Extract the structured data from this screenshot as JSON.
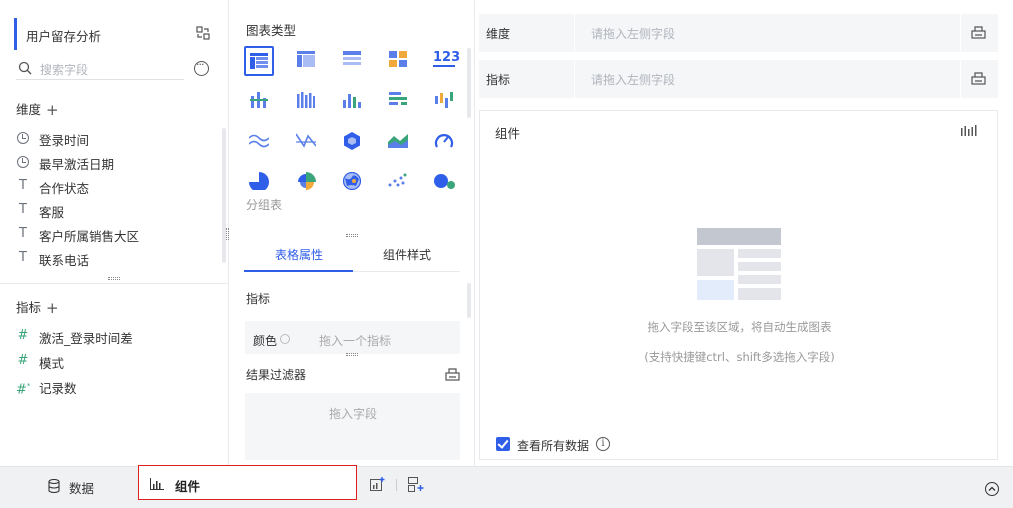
{
  "left_panel": {
    "dataset_title": "用户留存分析",
    "search_placeholder": "搜索字段",
    "dimension_title": "维度",
    "dimensions": [
      {
        "label": "登录时间",
        "icon": "clock-icon"
      },
      {
        "label": "最早激活日期",
        "icon": "clock-icon"
      },
      {
        "label": "合作状态",
        "icon": "text-type-icon"
      },
      {
        "label": "客服",
        "icon": "text-type-icon"
      },
      {
        "label": "客户所属销售大区",
        "icon": "text-type-icon"
      },
      {
        "label": "联系电话",
        "icon": "text-type-icon"
      }
    ],
    "metric_title": "指标",
    "metrics": [
      {
        "label": "激活_登录时间差",
        "icon": "hash-icon"
      },
      {
        "label": "模式",
        "icon": "hash-icon"
      },
      {
        "label": "记录数",
        "icon": "hash-star-icon"
      }
    ]
  },
  "middle_panel": {
    "chart_type_title": "图表类型",
    "group_table_label": "分组表",
    "tabs": [
      {
        "label": "表格属性",
        "active": true
      },
      {
        "label": "组件样式",
        "active": false
      }
    ],
    "metric_section": "指标",
    "color_label": "颜色",
    "color_placeholder": "拖入一个指标",
    "result_filter": "结果过滤器",
    "filter_placeholder": "拖入字段"
  },
  "right_panel": {
    "dimension_shelf": {
      "label": "维度",
      "placeholder": "请拖入左侧字段"
    },
    "metric_shelf": {
      "label": "指标",
      "placeholder": "请拖入左侧字段"
    },
    "canvas_title": "组件",
    "hint_line1": "拖入字段至该区域，将自动生成图表",
    "hint_line2": "(支持快捷键ctrl、shift多选拖入字段)",
    "view_all_data": "查看所有数据",
    "view_all_checked": true
  },
  "bottom_bar": {
    "data_tab": "数据",
    "component_tab": "组件"
  },
  "colors": {
    "accent": "#2f5ee8",
    "highlight_border": "#e02020"
  }
}
